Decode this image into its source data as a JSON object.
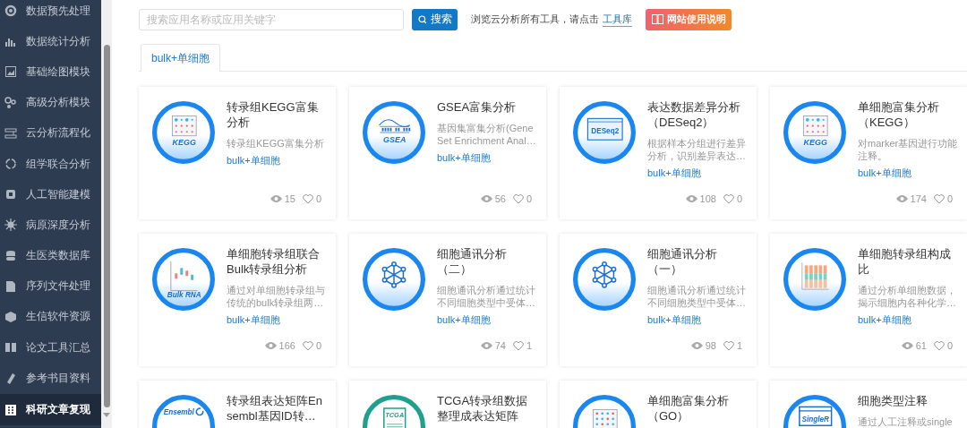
{
  "sidebar": {
    "items": [
      {
        "label": "数据预先处理",
        "kind": "gear",
        "selected": false
      },
      {
        "label": "数据统计分析",
        "kind": "bars",
        "selected": false
      },
      {
        "label": "基础绘图模块",
        "kind": "image",
        "selected": false
      },
      {
        "label": "高级分析模块",
        "kind": "bubbles",
        "selected": false
      },
      {
        "label": "云分析流程化",
        "kind": "flow",
        "selected": false
      },
      {
        "label": "组学联合分析",
        "kind": "cycle",
        "selected": false
      },
      {
        "label": "人工智能建模",
        "kind": "chip",
        "selected": false
      },
      {
        "label": "病原深度分析",
        "kind": "virus",
        "selected": false
      },
      {
        "label": "生医类数据库",
        "kind": "database",
        "selected": false
      },
      {
        "label": "序列文件处理",
        "kind": "file",
        "selected": false
      },
      {
        "label": "生信软件资源",
        "kind": "box",
        "selected": false
      },
      {
        "label": "论文工具汇总",
        "kind": "book",
        "selected": false
      },
      {
        "label": "参考书目资料",
        "kind": "eraser",
        "selected": false
      },
      {
        "label": "科研文章复现",
        "kind": "grid",
        "selected": true
      }
    ]
  },
  "search": {
    "placeholder": "搜索应用名称或应用关键字",
    "button": "搜索"
  },
  "hint": {
    "text": "浏览云分析所有工具，请点击",
    "link": "工具库"
  },
  "help_button": "网站使用说明",
  "tabs": [
    {
      "label": "bulk+单细胞",
      "selected": true
    }
  ],
  "cards": [
    {
      "kind": "kegg",
      "icon_label": "KEGG",
      "title": "转录组KEGG富集分析",
      "description": "转录组KEGG富集分析",
      "tag": "bulk+单细胞",
      "views": "15",
      "likes": "0"
    },
    {
      "kind": "gsea",
      "icon_label": "GSEA",
      "title": "GSEA富集分析",
      "description": "基因集富集分析(Gene Set Enrichment Anal…",
      "tag": "bulk+单细胞",
      "views": "56",
      "likes": "0"
    },
    {
      "kind": "deseq",
      "icon_label": "DESeq2",
      "title": "表达数据差异分析（DESeq2）",
      "description": "根据样本分组进行差异分析，识别差异表达…",
      "tag": "bulk+单细胞",
      "views": "108",
      "likes": "0"
    },
    {
      "kind": "kegg",
      "icon_label": "KEGG",
      "title": "单细胞富集分析（KEGG）",
      "description": "对marker基因进行功能注释。",
      "tag": "bulk+单细胞",
      "views": "174",
      "likes": "0"
    },
    {
      "kind": "bulk",
      "icon_label": "Bulk RNA",
      "title": "单细胞转录组联合Bulk转录组分析",
      "description": "通过对单细胞转录组与传统的bulk转录组两…",
      "tag": "bulk+单细胞",
      "views": "166",
      "likes": "0"
    },
    {
      "kind": "network",
      "title": "细胞通讯分析（二）",
      "description": "细胞通讯分析通过统计不同细胞类型中受体…",
      "tag": "bulk+单细胞",
      "views": "74",
      "likes": "1"
    },
    {
      "kind": "network",
      "title": "细胞通讯分析（一）",
      "description": "细胞通讯分析通过统计不同细胞类型中受体…",
      "tag": "bulk+单细胞",
      "views": "98",
      "likes": "1"
    },
    {
      "kind": "stack",
      "title": "单细胞转录组构成比",
      "description": "通过分析单细胞数据，揭示细胞内各种化学…",
      "tag": "bulk+单细胞",
      "views": "61",
      "likes": "0"
    },
    {
      "kind": "ensembl",
      "icon_label": "Ensembl",
      "title": "转录组表达矩阵Ensembl基因ID转…"
    },
    {
      "kind": "tcga",
      "icon_label": "TCGA",
      "title": "TCGA转录组数据整理成表达矩阵"
    },
    {
      "kind": "dots",
      "title": "单细胞富集分析（GO）"
    },
    {
      "kind": "singler",
      "icon_label": "SingleR",
      "title": "细胞类型注释",
      "description": "通过人工注释或single"
    }
  ]
}
